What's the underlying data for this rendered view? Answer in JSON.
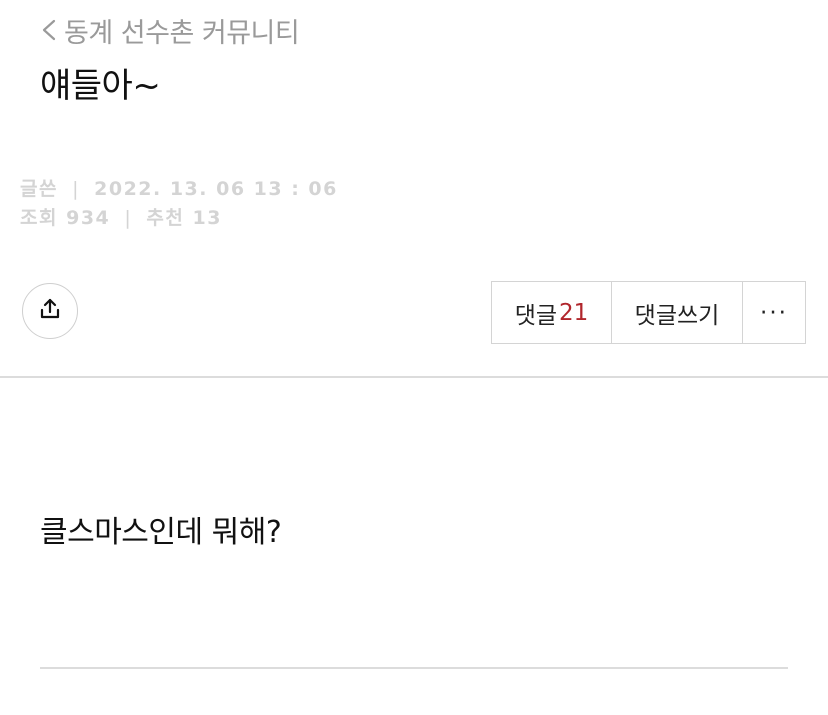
{
  "header": {
    "back_label": "동계 선수촌 커뮤니티"
  },
  "post": {
    "title": "얘들아~",
    "author_label": "글쓴",
    "datetime": "2022. 13. 06 13 : 06",
    "views_label": "조회",
    "views": "934",
    "recommend_label": "추천",
    "recommends": "13",
    "separator": "|",
    "body": "클스마스인데 뭐해?"
  },
  "actions": {
    "comments_label": "댓글",
    "comments_count": "21",
    "write_comment_label": "댓글쓰기",
    "more_label": "···"
  },
  "colors": {
    "accent": "#b1262c",
    "meta_text": "#d4d4d4",
    "back_text": "#9a9a9a"
  },
  "icons": {
    "back": "chevron-left-icon",
    "share": "share-icon"
  }
}
